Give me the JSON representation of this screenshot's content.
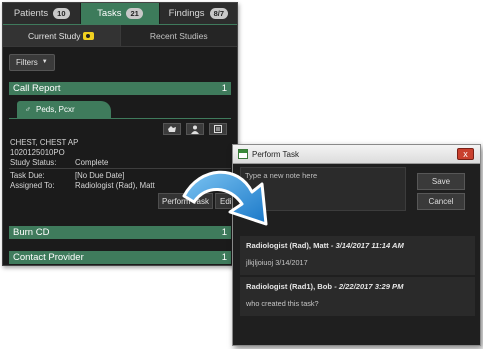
{
  "worklist": {
    "tabs": [
      {
        "label": "Patients",
        "count": "10"
      },
      {
        "label": "Tasks",
        "count": "21"
      },
      {
        "label": "Findings",
        "count": "8/7"
      }
    ],
    "subtabs": {
      "current": "Current Study",
      "recent": "Recent Studies"
    },
    "filters_label": "Filters",
    "sections": [
      {
        "title": "Call Report",
        "count": "1"
      },
      {
        "title": "Burn CD",
        "count": "1"
      },
      {
        "title": "Contact Provider",
        "count": "1"
      }
    ],
    "patient": {
      "gender_symbol": "♂",
      "name": "Peds, Pcxr"
    },
    "study": {
      "description": "CHEST, CHEST AP",
      "accession": "1020125010PO",
      "status_label": "Study Status:",
      "status_value": "Complete",
      "task_due_label": "Task Due:",
      "task_due_value": "[No Due Date]",
      "assigned_label": "Assigned To:",
      "assigned_value": "Radiologist (Rad), Matt"
    },
    "buttons": {
      "perform_task": "Perform Task",
      "edit": "Edit"
    }
  },
  "dialog": {
    "title": "Perform Task",
    "close_glyph": "x",
    "note_placeholder": "Type a new note here",
    "save_label": "Save",
    "cancel_label": "Cancel",
    "comments": [
      {
        "author": "Radiologist (Rad), Matt",
        "date": "3/14/2017 11:14 AM",
        "text": "jlkjljoiuoj 3/14/2017"
      },
      {
        "author": "Radiologist (Rad1), Bob",
        "date": "2/22/2017 3:29 PM",
        "text": "who created this task?"
      }
    ]
  },
  "colors": {
    "accent_green": "#3f7b5c",
    "panel_bg": "#1b1b1b",
    "arrow_blue": "#1e88d6"
  }
}
